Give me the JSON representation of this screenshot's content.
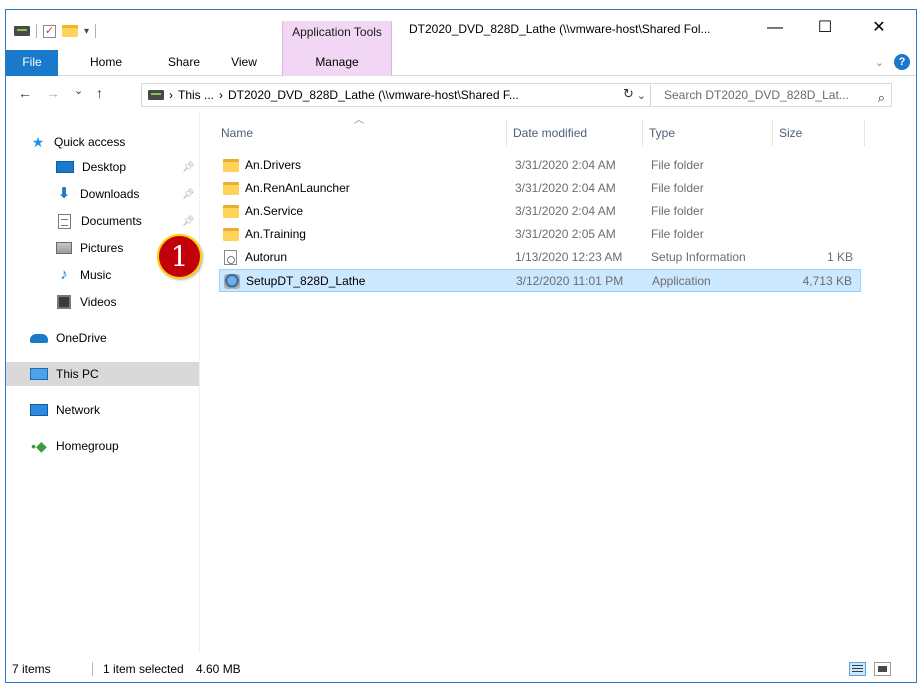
{
  "window": {
    "title": "DT2020_DVD_828D_Lathe (\\\\vmware-host\\Shared Fol...",
    "context_tab": "Application Tools",
    "minimize": "—",
    "maximize": "☐",
    "close": "✕"
  },
  "ribbon": {
    "tabs": [
      "File",
      "Home",
      "Share",
      "View",
      "Manage"
    ],
    "help": "?"
  },
  "address": {
    "back": "←",
    "forward": "→",
    "recent": "⌄",
    "up": "↑",
    "crumb_root": "This ...",
    "crumb_sep": "›",
    "crumb_path": "DT2020_DVD_828D_Lathe (\\\\vmware-host\\Shared F...",
    "refresh": "↻",
    "search_placeholder": "Search DT2020_DVD_828D_Lat...",
    "search_icon": "⌕"
  },
  "nav": {
    "items": [
      {
        "label": "Quick access",
        "icon": "star-icon"
      },
      {
        "label": "Desktop",
        "icon": "desktop-icon",
        "pinned": true
      },
      {
        "label": "Downloads",
        "icon": "download-icon",
        "pinned": true
      },
      {
        "label": "Documents",
        "icon": "documents-icon",
        "pinned": true
      },
      {
        "label": "Pictures",
        "icon": "pictures-icon"
      },
      {
        "label": "Music",
        "icon": "music-icon"
      },
      {
        "label": "Videos",
        "icon": "videos-icon"
      },
      {
        "label": "OneDrive",
        "icon": "onedrive-icon"
      },
      {
        "label": "This PC",
        "icon": "this-pc-icon",
        "selected": true
      },
      {
        "label": "Network",
        "icon": "network-icon"
      },
      {
        "label": "Homegroup",
        "icon": "homegroup-icon"
      }
    ]
  },
  "columns": {
    "name": "Name",
    "date": "Date modified",
    "type": "Type",
    "size": "Size"
  },
  "files": [
    {
      "name": "An.Drivers",
      "date": "3/31/2020 2:04 AM",
      "type": "File folder",
      "size": "",
      "icon": "folder-icon"
    },
    {
      "name": "An.RenAnLauncher",
      "date": "3/31/2020 2:04 AM",
      "type": "File folder",
      "size": "",
      "icon": "folder-icon"
    },
    {
      "name": "An.Service",
      "date": "3/31/2020 2:04 AM",
      "type": "File folder",
      "size": "",
      "icon": "folder-icon"
    },
    {
      "name": "An.Training",
      "date": "3/31/2020 2:05 AM",
      "type": "File folder",
      "size": "",
      "icon": "folder-icon"
    },
    {
      "name": "Autorun",
      "date": "1/13/2020 12:23 AM",
      "type": "Setup Information",
      "size": "1 KB",
      "icon": "setup-info-icon"
    },
    {
      "name": "SetupDT_828D_Lathe",
      "date": "3/12/2020 11:01 PM",
      "type": "Application",
      "size": "4,713 KB",
      "icon": "application-icon",
      "selected": true
    }
  ],
  "callout": "1",
  "status": {
    "items": "7 items",
    "selected": "1 item selected",
    "size": "4.60 MB"
  }
}
